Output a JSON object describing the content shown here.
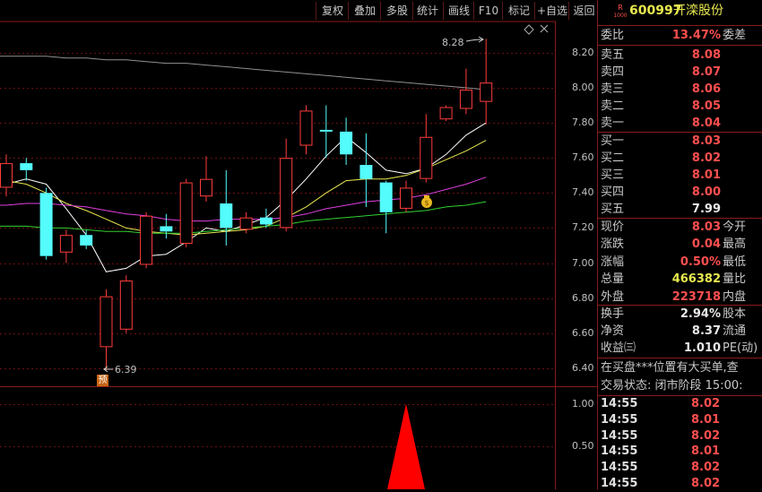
{
  "toolbar": {
    "buttons": [
      "复权",
      "叠加",
      "多股",
      "统计",
      "画线",
      "F10",
      "标记",
      "+自选",
      "返回"
    ]
  },
  "chart": {
    "top_label": "8.28",
    "low_label": "6.39",
    "pre_badge": "预",
    "colors": {
      "up": "#ff3c3c",
      "down": "#54fcfc",
      "ma_white": "#ffffff",
      "ma_yellow": "#e8e850",
      "ma_magenta": "#e040e0",
      "ma_green": "#30d030",
      "ma_long": "#909090",
      "grid": "#6a0f0f",
      "arrow": "#ff0000"
    }
  },
  "chart_data": [
    {
      "type": "candlestick",
      "y_ticks": [
        "8.20",
        "8.00",
        "7.80",
        "7.60",
        "7.40",
        "7.20",
        "7.00",
        "6.80",
        "6.60",
        "6.40"
      ],
      "ylim": [
        6.35,
        8.35
      ],
      "annotations": [
        "8.28",
        "6.39"
      ],
      "candles": [
        {
          "o": 7.43,
          "c": 7.57,
          "h": 7.62,
          "l": 7.38
        },
        {
          "o": 7.57,
          "c": 7.53,
          "h": 7.6,
          "l": 7.47
        },
        {
          "o": 7.4,
          "c": 7.04,
          "h": 7.43,
          "l": 7.02
        },
        {
          "o": 7.06,
          "c": 7.16,
          "h": 7.19,
          "l": 7.0
        },
        {
          "o": 7.16,
          "c": 7.1,
          "h": 7.19,
          "l": 7.08
        },
        {
          "o": 6.52,
          "c": 6.81,
          "h": 6.85,
          "l": 6.39
        },
        {
          "o": 6.62,
          "c": 6.9,
          "h": 6.93,
          "l": 6.6
        },
        {
          "o": 6.99,
          "c": 7.27,
          "h": 7.29,
          "l": 6.97
        },
        {
          "o": 7.21,
          "c": 7.18,
          "h": 7.28,
          "l": 7.14
        },
        {
          "o": 7.11,
          "c": 7.46,
          "h": 7.48,
          "l": 7.09
        },
        {
          "o": 7.38,
          "c": 7.48,
          "h": 7.61,
          "l": 7.35
        },
        {
          "o": 7.34,
          "c": 7.2,
          "h": 7.53,
          "l": 7.1
        },
        {
          "o": 7.19,
          "c": 7.26,
          "h": 7.29,
          "l": 7.17
        },
        {
          "o": 7.26,
          "c": 7.22,
          "h": 7.31,
          "l": 7.2
        },
        {
          "o": 7.2,
          "c": 7.6,
          "h": 7.71,
          "l": 7.18
        },
        {
          "o": 7.67,
          "c": 7.87,
          "h": 7.9,
          "l": 7.62
        },
        {
          "o": 7.76,
          "c": 7.75,
          "h": 7.9,
          "l": 7.6
        },
        {
          "o": 7.75,
          "c": 7.62,
          "h": 7.83,
          "l": 7.56
        },
        {
          "o": 7.56,
          "c": 7.48,
          "h": 7.74,
          "l": 7.32
        },
        {
          "o": 7.46,
          "c": 7.29,
          "h": 7.47,
          "l": 7.17
        },
        {
          "o": 7.31,
          "c": 7.43,
          "h": 7.47,
          "l": 7.29
        },
        {
          "o": 7.48,
          "c": 7.72,
          "h": 7.85,
          "l": 7.46
        },
        {
          "o": 7.82,
          "c": 7.89,
          "h": 7.9,
          "l": 7.81
        },
        {
          "o": 7.88,
          "c": 7.99,
          "h": 8.11,
          "l": 7.85
        },
        {
          "o": 7.92,
          "c": 8.03,
          "h": 8.28,
          "l": 7.79
        }
      ],
      "ma": {
        "white": [
          7.45,
          7.48,
          7.45,
          7.31,
          7.16,
          6.95,
          6.97,
          7.04,
          7.05,
          7.12,
          7.2,
          7.18,
          7.22,
          7.26,
          7.36,
          7.48,
          7.61,
          7.72,
          7.63,
          7.53,
          7.51,
          7.54,
          7.62,
          7.73,
          7.8
        ],
        "yellow": [
          7.47,
          7.45,
          7.4,
          7.34,
          7.3,
          7.25,
          7.2,
          7.18,
          7.17,
          7.16,
          7.17,
          7.18,
          7.19,
          7.21,
          7.26,
          7.32,
          7.4,
          7.47,
          7.48,
          7.48,
          7.5,
          7.54,
          7.59,
          7.64,
          7.7
        ],
        "magenta": [
          7.33,
          7.34,
          7.34,
          7.33,
          7.32,
          7.3,
          7.28,
          7.27,
          7.25,
          7.24,
          7.24,
          7.25,
          7.25,
          7.25,
          7.26,
          7.28,
          7.31,
          7.33,
          7.35,
          7.36,
          7.37,
          7.39,
          7.42,
          7.45,
          7.49
        ],
        "green": [
          7.21,
          7.21,
          7.2,
          7.2,
          7.19,
          7.18,
          7.18,
          7.17,
          7.17,
          7.17,
          7.18,
          7.19,
          7.2,
          7.21,
          7.22,
          7.24,
          7.25,
          7.26,
          7.27,
          7.28,
          7.29,
          7.3,
          7.32,
          7.33,
          7.35
        ],
        "long": [
          8.18,
          8.18,
          8.18,
          8.17,
          8.17,
          8.16,
          8.16,
          8.15,
          8.14,
          8.14,
          8.13,
          8.12,
          8.11,
          8.1,
          8.09,
          8.08,
          8.07,
          8.06,
          8.05,
          8.04,
          8.03,
          8.02,
          8.01,
          8.0,
          7.99
        ]
      }
    },
    {
      "type": "bar",
      "y_ticks": [
        "1.00",
        "0.50"
      ],
      "ylim": [
        0,
        1.2
      ],
      "signal": {
        "index": 20,
        "value": 1.0
      }
    }
  ],
  "panel": {
    "code": "600997",
    "name": "开滦股份",
    "r_badge_top": "R",
    "r_badge_bottom": "1000",
    "weibi": {
      "label": "委比",
      "value": "13.47%",
      "label2": "委差"
    },
    "asks": [
      {
        "label": "卖五",
        "price": "8.08"
      },
      {
        "label": "卖四",
        "price": "8.07"
      },
      {
        "label": "卖三",
        "price": "8.06"
      },
      {
        "label": "卖二",
        "price": "8.05"
      },
      {
        "label": "卖一",
        "price": "8.04"
      }
    ],
    "bids": [
      {
        "label": "买一",
        "price": "8.03",
        "color": "red"
      },
      {
        "label": "买二",
        "price": "8.02",
        "color": "red"
      },
      {
        "label": "买三",
        "price": "8.01",
        "color": "red"
      },
      {
        "label": "买四",
        "price": "8.00",
        "color": "red"
      },
      {
        "label": "买五",
        "price": "7.99",
        "color": "white"
      }
    ],
    "quote": [
      {
        "label": "现价",
        "value": "8.03",
        "label2": "今开",
        "color": "red"
      },
      {
        "label": "涨跌",
        "value": "0.04",
        "label2": "最高",
        "color": "red"
      },
      {
        "label": "涨幅",
        "value": "0.50%",
        "label2": "最低",
        "color": "red"
      },
      {
        "label": "总量",
        "value": "466382",
        "label2": "量比",
        "color": "yellow"
      },
      {
        "label": "外盘",
        "value": "223718",
        "label2": "内盘",
        "color": "red"
      }
    ],
    "fin": [
      {
        "label": "换手",
        "value": "2.94%",
        "label2": "股本"
      },
      {
        "label": "净资",
        "value": "8.37",
        "label2": "流通"
      },
      {
        "label": "收益㈢",
        "value": "1.010",
        "label2": "PE(动)"
      }
    ],
    "marquee": "在买盘***位置有大买单,查",
    "status": "交易状态: 闭市阶段 15:00:",
    "ticks": [
      {
        "time": "14:55",
        "price": "8.02"
      },
      {
        "time": "14:55",
        "price": "8.01"
      },
      {
        "time": "14:55",
        "price": "8.02"
      },
      {
        "time": "14:55",
        "price": "8.01"
      },
      {
        "time": "14:55",
        "price": "8.02"
      },
      {
        "time": "14:55",
        "price": "8.02"
      }
    ]
  }
}
